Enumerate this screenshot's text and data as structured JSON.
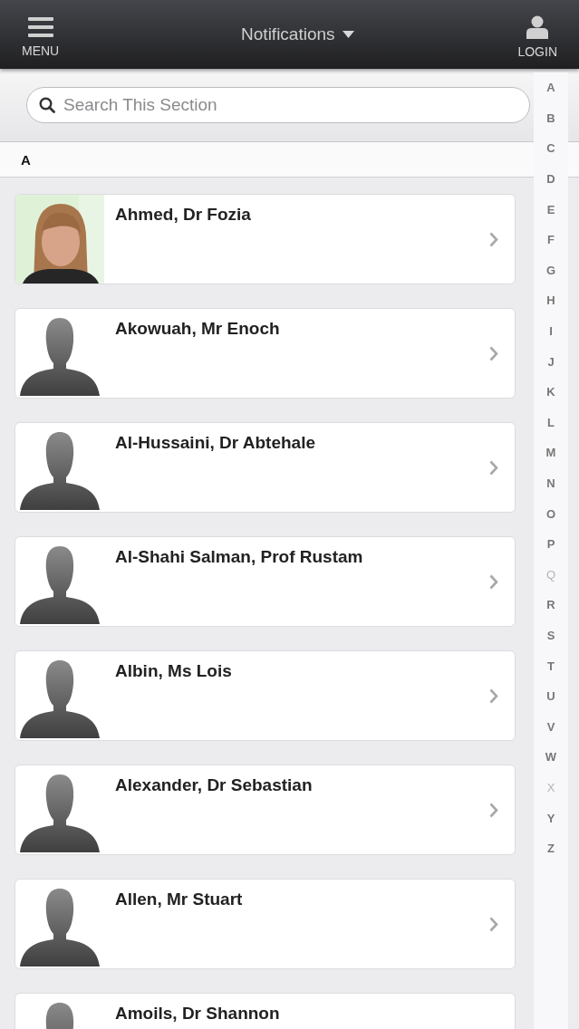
{
  "header": {
    "menu_label": "MENU",
    "title": "Notifications",
    "login_label": "LOGIN"
  },
  "search": {
    "placeholder": "Search This Section"
  },
  "section": {
    "heading": "A"
  },
  "people": [
    {
      "name": "Ahmed, Dr Fozia"
    },
    {
      "name": "Akowuah, Mr Enoch",
      "kind": "silhouette"
    },
    {
      "name": "Al-Hussaini, Dr Abtehale",
      "kind": "silhouette"
    },
    {
      "name": "Al-Shahi Salman, Prof Rustam",
      "kind": "silhouette"
    },
    {
      "name": "Albin, Ms Lois",
      "kind": "silhouette"
    },
    {
      "name": "Alexander, Dr Sebastian",
      "kind": "silhouette"
    },
    {
      "name": "Allen, Mr Stuart",
      "kind": "silhouette"
    },
    {
      "name": "Amoils, Dr Shannon",
      "kind": "silhouette"
    }
  ],
  "index": [
    {
      "letter": "A",
      "disabled": false
    },
    {
      "letter": "B",
      "disabled": false
    },
    {
      "letter": "C",
      "disabled": false
    },
    {
      "letter": "D",
      "disabled": false
    },
    {
      "letter": "E",
      "disabled": false
    },
    {
      "letter": "F",
      "disabled": false
    },
    {
      "letter": "G",
      "disabled": false
    },
    {
      "letter": "H",
      "disabled": false
    },
    {
      "letter": "I",
      "disabled": false
    },
    {
      "letter": "J",
      "disabled": false
    },
    {
      "letter": "K",
      "disabled": false
    },
    {
      "letter": "L",
      "disabled": false
    },
    {
      "letter": "M",
      "disabled": false
    },
    {
      "letter": "N",
      "disabled": false
    },
    {
      "letter": "O",
      "disabled": false
    },
    {
      "letter": "P",
      "disabled": false
    },
    {
      "letter": "Q",
      "disabled": true
    },
    {
      "letter": "R",
      "disabled": false
    },
    {
      "letter": "S",
      "disabled": false
    },
    {
      "letter": "T",
      "disabled": false
    },
    {
      "letter": "U",
      "disabled": false
    },
    {
      "letter": "V",
      "disabled": false
    },
    {
      "letter": "W",
      "disabled": false
    },
    {
      "letter": "X",
      "disabled": true
    },
    {
      "letter": "Y",
      "disabled": false
    },
    {
      "letter": "Z",
      "disabled": false
    }
  ]
}
